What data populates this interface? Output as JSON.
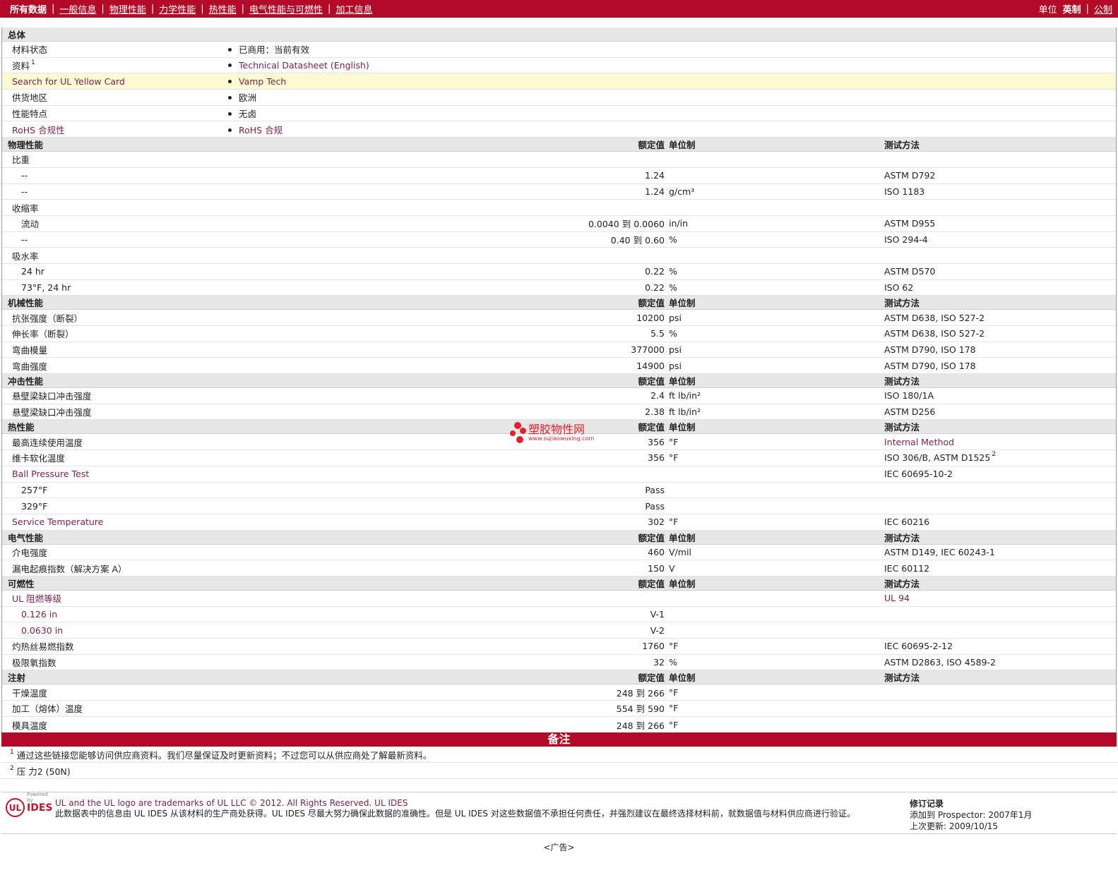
{
  "nav": {
    "items": [
      "所有数据",
      "一般信息",
      "物理性能",
      "力学性能",
      "热性能",
      "电气性能与可燃性",
      "加工信息"
    ],
    "units_label": "单位",
    "unit_current": "英制",
    "unit_alt": "公制"
  },
  "general": {
    "title": "总体",
    "rows": [
      {
        "name": "材料状态",
        "value": "已商用：当前有效"
      },
      {
        "name": "资料",
        "value": "Technical Datasheet (English)"
      },
      {
        "name": "Search for UL Yellow Card",
        "value": "Vamp Tech"
      },
      {
        "name": "供货地区",
        "value": "欧洲"
      },
      {
        "name": "性能特点",
        "value": "无卤"
      },
      {
        "name": "RoHS 合规性",
        "value": "RoHS 合规"
      }
    ]
  },
  "col_headers": {
    "value": "额定值",
    "unit": "单位制",
    "method": "测试方法"
  },
  "physical": {
    "title": "物理性能",
    "sg_label": "比重",
    "sg1": {
      "name": "--",
      "value": "1.24",
      "method": "ASTM D792"
    },
    "sg2": {
      "name": "--",
      "value": "1.24",
      "unit": "g/cm³",
      "method": "ISO 1183"
    },
    "shrink_label": "收缩率",
    "shrink1": {
      "name": "流动",
      "from": "0.0040",
      "to_word": "到",
      "to": "0.0060",
      "unit": "in/in",
      "method": "ASTM D955"
    },
    "shrink2": {
      "name": "--",
      "from": "0.40",
      "to_word": "到",
      "to": "0.60",
      "unit": "%",
      "method": "ISO 294-4"
    },
    "water_label": "吸水率",
    "water1": {
      "name": "24 hr",
      "value": "0.22",
      "unit": "%",
      "method": "ASTM D570"
    },
    "water2": {
      "name": "73°F, 24 hr",
      "value": "0.22",
      "unit": "%",
      "method": "ISO 62"
    }
  },
  "mechanical": {
    "title": "机械性能",
    "r1": {
      "name": "抗张强度（断裂）",
      "value": "10200",
      "unit": "psi",
      "method": "ASTM D638, ISO 527-2"
    },
    "r2": {
      "name": "伸长率（断裂）",
      "value": "5.5",
      "unit": "%",
      "method": "ASTM D638, ISO 527-2"
    },
    "r3": {
      "name": "弯曲模量",
      "value": "377000",
      "unit": "psi",
      "method": "ASTM D790, ISO 178"
    },
    "r4": {
      "name": "弯曲强度",
      "value": "14900",
      "unit": "psi",
      "method": "ASTM D790, ISO 178"
    }
  },
  "impact": {
    "title": "冲击性能",
    "r1": {
      "name": "悬壁梁缺口冲击强度",
      "value": "2.4",
      "unit": "ft lb/in²",
      "method": "ISO 180/1A"
    },
    "r2": {
      "name": "悬壁梁缺口冲击强度",
      "value": "2.38",
      "unit": "ft lb/in²",
      "method": "ASTM D256"
    }
  },
  "thermal": {
    "title": "热性能",
    "r1": {
      "name": "最高连续使用温度",
      "value": "356",
      "unit": "°F",
      "method": "Internal Method"
    },
    "r2": {
      "name": "维卡软化温度",
      "value": "356",
      "unit": "°F",
      "method": "ISO 306/B, ASTM D1525",
      "ref": "2"
    },
    "ball": {
      "name": "Ball Pressure Test",
      "method": "IEC 60695-10-2"
    },
    "b1": {
      "name": "257°F",
      "value": "Pass"
    },
    "b2": {
      "name": "329°F",
      "value": "Pass"
    },
    "svc": {
      "name": "Service Temperature",
      "value": "302",
      "unit": "°F",
      "method": "IEC 60216"
    }
  },
  "electrical": {
    "title": "电气性能",
    "r1": {
      "name": "介电强度",
      "value": "460",
      "unit": "V/mil",
      "method": "ASTM D149, IEC 60243-1"
    },
    "r2": {
      "name": "漏电起痕指数（解决方案 A）",
      "value": "150",
      "unit": "V",
      "method": "IEC 60112"
    }
  },
  "flammability": {
    "title": "可燃性",
    "ul": {
      "name": "UL 阻燃等级",
      "method": "UL 94"
    },
    "u1": {
      "name": "0.126 in",
      "value": "V-1"
    },
    "u2": {
      "name": "0.0630 in",
      "value": "V-2"
    },
    "r1": {
      "name": "灼热丝易燃指数",
      "value": "1760",
      "unit": "°F",
      "method": "IEC 60695-2-12"
    },
    "r2": {
      "name": "极限氧指数",
      "value": "32",
      "unit": "%",
      "method": "ASTM D2863, ISO 4589-2"
    }
  },
  "injection": {
    "title": "注射",
    "r1": {
      "name": "干燥温度",
      "from": "248",
      "to_word": "到",
      "to": "266",
      "unit": "°F"
    },
    "r2": {
      "name": "加工（熔体）温度",
      "from": "554",
      "to_word": "到",
      "to": "590",
      "unit": "°F"
    },
    "r3": {
      "name": "模具温度",
      "from": "248",
      "to_word": "到",
      "to": "266",
      "unit": "°F"
    }
  },
  "notes": {
    "title": "备注",
    "n1": {
      "num": "1",
      "text": "通过这些链接您能够访问供应商资料。我们尽量保证及时更新资料；不过您可以从供应商处了解最新资料。"
    },
    "n2": {
      "num": "2",
      "text": "压 力2 (50N)"
    }
  },
  "footer": {
    "logo_powered": "Powered by",
    "logo_ul": "UL",
    "logo_ides": "IDES",
    "line1": "UL and the UL logo are trademarks of UL LLC © 2012. All Rights Reserved. UL IDES",
    "line2": "此数据表中的信息由  UL IDES 从该材料的生产商处获得。UL IDES 尽最大努力确保此数据的准确性。但是  UL IDES 对这些数据值不承担任何责任，并强烈建议在最终选择材料前，就数据值与材料供应商进行验证。",
    "rev_title": "修订记录",
    "rev_added": "添加到  Prospector:   2007年1月",
    "rev_updated": "上次更新:   2009/10/15",
    "ad": "<广告>"
  },
  "watermark": {
    "text": "塑胶物性网",
    "url": "www.sujiaowuxing.com"
  }
}
